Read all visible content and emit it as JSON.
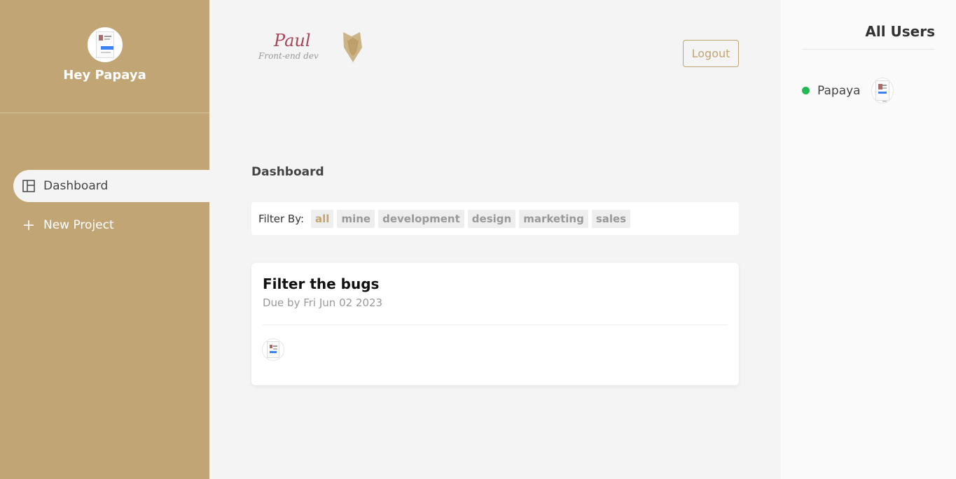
{
  "sidebar": {
    "greeting": "Hey Papaya",
    "nav": [
      {
        "label": "Dashboard",
        "icon": "layout-icon",
        "active": true
      },
      {
        "label": "New Project",
        "icon": "plus-icon",
        "active": false
      }
    ]
  },
  "header": {
    "logo_name": "Paul",
    "logo_tagline": "Front-end dev",
    "logout_label": "Logout"
  },
  "main": {
    "title": "Dashboard",
    "filter": {
      "label": "Filter By:",
      "options": [
        "all",
        "mine",
        "development",
        "design",
        "marketing",
        "sales"
      ],
      "active": "all"
    },
    "projects": [
      {
        "title": "Filter the bugs",
        "due": "Due by Fri Jun 02 2023"
      }
    ]
  },
  "users_panel": {
    "title": "All Users",
    "users": [
      {
        "name": "Papaya",
        "online": true
      }
    ]
  },
  "colors": {
    "accent": "#c2a574",
    "online": "#1fba52",
    "logo_red": "#a8455a"
  }
}
